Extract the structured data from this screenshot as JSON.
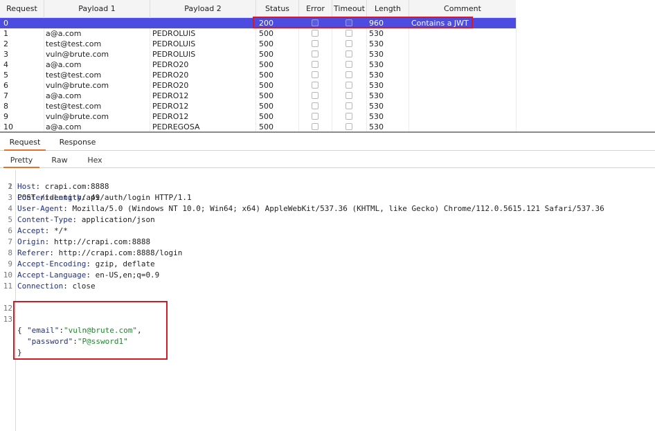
{
  "table": {
    "headers": [
      "Request",
      "Payload 1",
      "Payload 2",
      "Status",
      "Error",
      "Timeout",
      "Length",
      "Comment"
    ],
    "rows": [
      {
        "request": "0",
        "payload1": "",
        "payload2": "",
        "status": "200",
        "length": "960",
        "comment": "Contains a JWT",
        "selected": true
      },
      {
        "request": "1",
        "payload1": "a@a.com",
        "payload2": "PEDROLUIS",
        "status": "500",
        "length": "530",
        "comment": ""
      },
      {
        "request": "2",
        "payload1": "test@test.com",
        "payload2": "PEDROLUIS",
        "status": "500",
        "length": "530",
        "comment": ""
      },
      {
        "request": "3",
        "payload1": "vuln@brute.com",
        "payload2": "PEDROLUIS",
        "status": "500",
        "length": "530",
        "comment": ""
      },
      {
        "request": "4",
        "payload1": "a@a.com",
        "payload2": "PEDRO20",
        "status": "500",
        "length": "530",
        "comment": ""
      },
      {
        "request": "5",
        "payload1": "test@test.com",
        "payload2": "PEDRO20",
        "status": "500",
        "length": "530",
        "comment": ""
      },
      {
        "request": "6",
        "payload1": "vuln@brute.com",
        "payload2": "PEDRO20",
        "status": "500",
        "length": "530",
        "comment": ""
      },
      {
        "request": "7",
        "payload1": "a@a.com",
        "payload2": "PEDRO12",
        "status": "500",
        "length": "530",
        "comment": ""
      },
      {
        "request": "8",
        "payload1": "test@test.com",
        "payload2": "PEDRO12",
        "status": "500",
        "length": "530",
        "comment": ""
      },
      {
        "request": "9",
        "payload1": "vuln@brute.com",
        "payload2": "PEDRO12",
        "status": "500",
        "length": "530",
        "comment": ""
      },
      {
        "request": "10",
        "payload1": "a@a.com",
        "payload2": "PEDREGOSA",
        "status": "500",
        "length": "530",
        "comment": ""
      }
    ]
  },
  "tabs": {
    "main": [
      "Request",
      "Response"
    ],
    "view": [
      "Pretty",
      "Raw",
      "Hex"
    ]
  },
  "editor": {
    "request_line": "POST /identity/api/auth/login HTTP/1.1",
    "headers": [
      {
        "name": "Host",
        "value": " crapi.com:8888"
      },
      {
        "name": "Content-Length",
        "value": " 49"
      },
      {
        "name": "User-Agent",
        "value": " Mozilla/5.0 (Windows NT 10.0; Win64; x64) AppleWebKit/537.36 (KHTML, like Gecko) Chrome/112.0.5615.121 Safari/537.36"
      },
      {
        "name": "Content-Type",
        "value": " application/json"
      },
      {
        "name": "Accept",
        "value": " */*"
      },
      {
        "name": "Origin",
        "value": " http://crapi.com:8888"
      },
      {
        "name": "Referer",
        "value": " http://crapi.com:8888/login"
      },
      {
        "name": "Accept-Encoding",
        "value": " gzip, deflate"
      },
      {
        "name": "Accept-Language",
        "value": " en-US,en;q=0.9"
      },
      {
        "name": "Connection",
        "value": " close"
      }
    ],
    "body": {
      "open": "{",
      "email_key": "\"email\"",
      "email_value": "\"vuln@brute.com\"",
      "password_key": "\"password\"",
      "password_value": "\"P@ssword1\"",
      "close": "}"
    },
    "line_numbers": [
      "1",
      "2",
      "3",
      "4",
      "5",
      "6",
      "7",
      "8",
      "9",
      "10",
      "11",
      "12",
      "13"
    ]
  },
  "colors": {
    "selected_row": "#4c4ce0",
    "highlight": "#e0161c",
    "tab_accent": "#e8702a"
  }
}
